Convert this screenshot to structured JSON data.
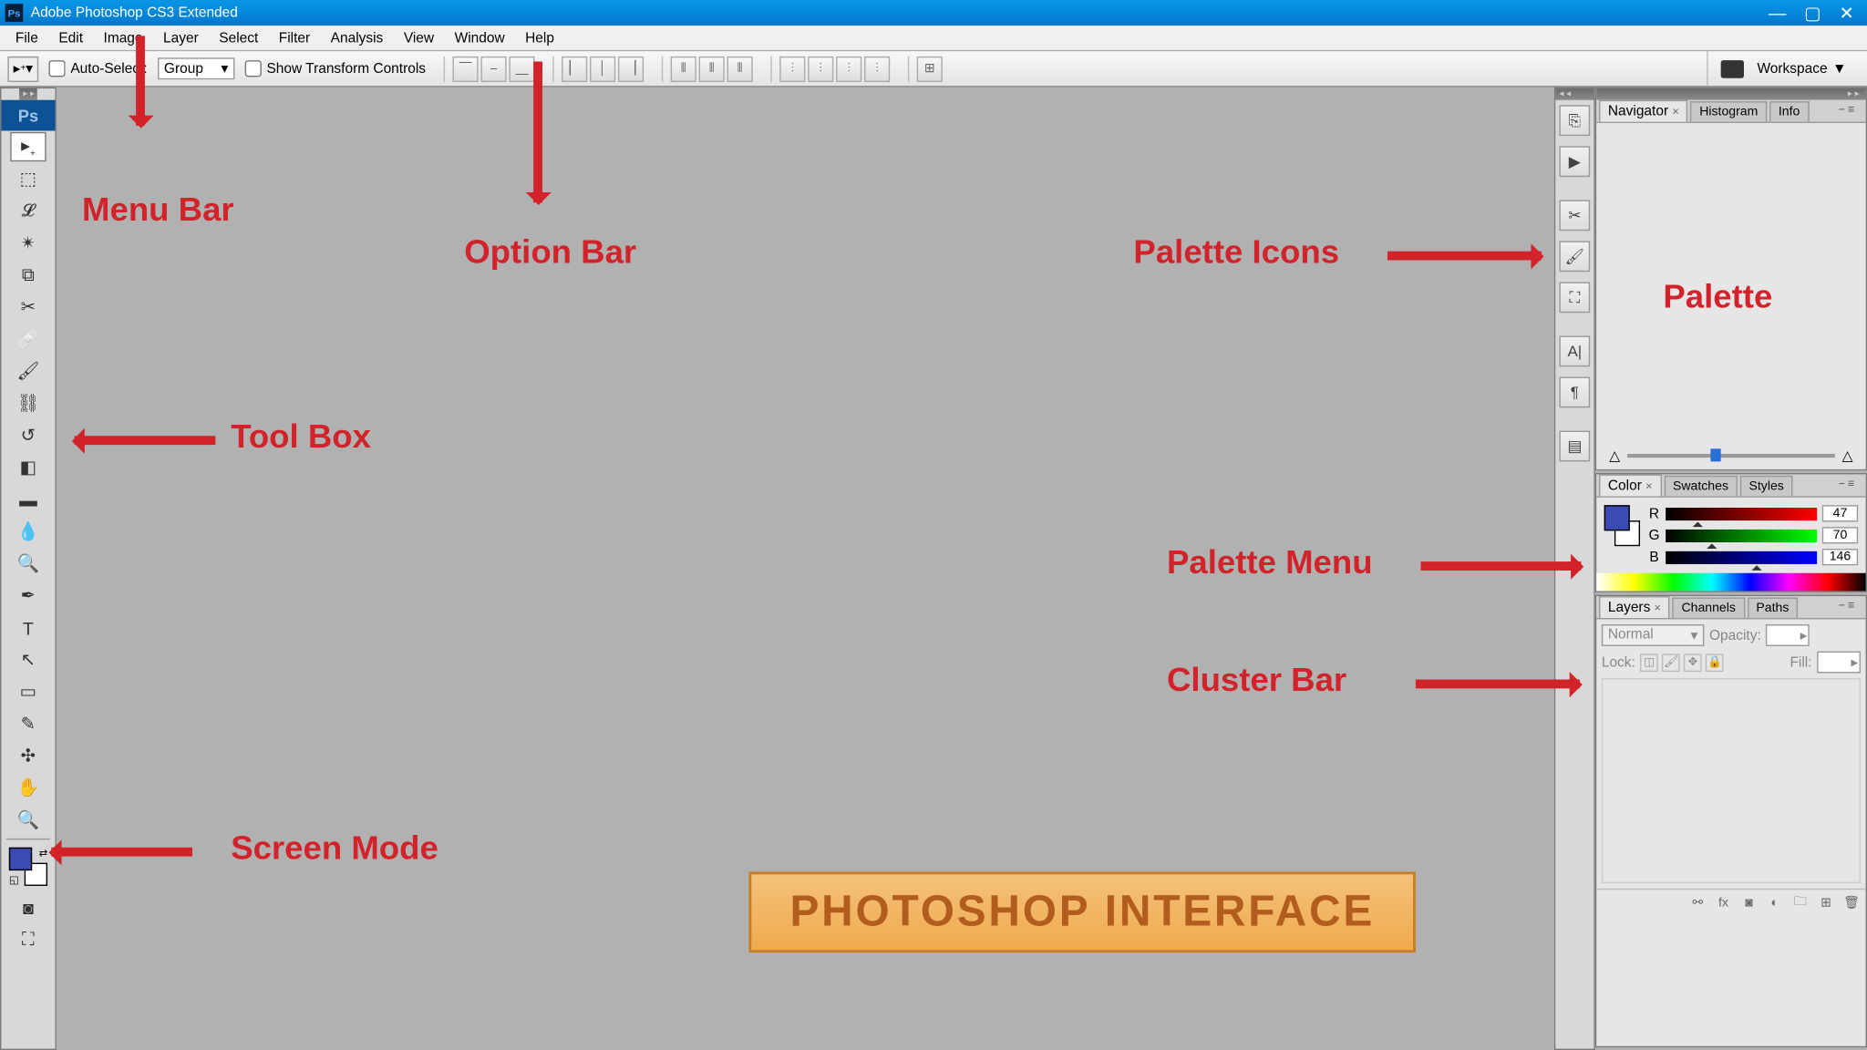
{
  "title": "Adobe Photoshop CS3 Extended",
  "menu": [
    "File",
    "Edit",
    "Image",
    "Layer",
    "Select",
    "Filter",
    "Analysis",
    "View",
    "Window",
    "Help"
  ],
  "options": {
    "auto_select": "Auto-Select:",
    "group": "Group",
    "show_transform": "Show Transform Controls",
    "workspace": "Workspace"
  },
  "navigator_tabs": [
    "Navigator",
    "Histogram",
    "Info"
  ],
  "color_tabs": [
    "Color",
    "Swatches",
    "Styles"
  ],
  "layers_tabs": [
    "Layers",
    "Channels",
    "Paths"
  ],
  "color": {
    "r": "47",
    "g": "70",
    "b": "146"
  },
  "layers": {
    "blend": "Normal",
    "opacity_label": "Opacity:",
    "lock_label": "Lock:",
    "fill_label": "Fill:"
  },
  "annotations": {
    "menu_bar": "Menu Bar",
    "option_bar": "Option Bar",
    "palette_icons": "Palette Icons",
    "palette": "Palette",
    "tool_box": "Tool Box",
    "palette_menu": "Palette Menu",
    "cluster_bar": "Cluster Bar",
    "screen_mode": "Screen Mode",
    "banner": "PHOTOSHOP INTERFACE"
  }
}
